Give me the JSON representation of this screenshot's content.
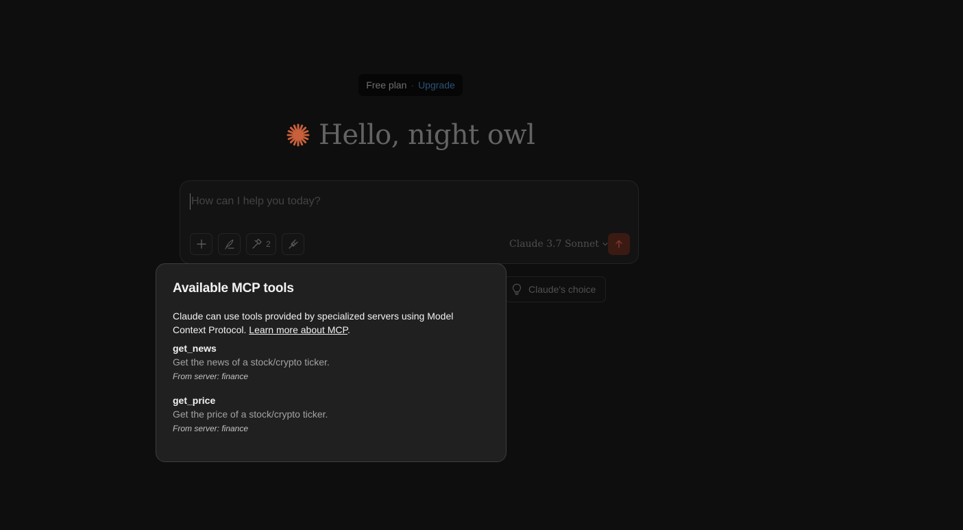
{
  "plan": {
    "label": "Free plan",
    "separator": "·",
    "upgrade_label": "Upgrade"
  },
  "greeting": {
    "icon": "asterisk-icon",
    "text": "Hello, night owl"
  },
  "composer": {
    "placeholder": "How can I help you today?",
    "value": "",
    "tools_count": "2",
    "model_label": "Claude 3.7 Sonnet"
  },
  "suggestions": {
    "claude_choice_label": "Claude's choice"
  },
  "mcp_popover": {
    "title": "Available MCP tools",
    "description": "Claude can use tools provided by specialized servers using Model Context Protocol.",
    "learn_more_label": "Learn more about MCP",
    "description_suffix": ".",
    "tools": [
      {
        "name": "get_news",
        "description": "Get the news of a stock/crypto ticker.",
        "server": "From server: finance"
      },
      {
        "name": "get_price",
        "description": "Get the price of a stock/crypto ticker.",
        "server": "From server: finance"
      }
    ]
  },
  "colors": {
    "background": "#0e0e0e",
    "accent": "#d2693f",
    "upgrade_link": "#2a5277",
    "popover_bg": "#202020"
  }
}
